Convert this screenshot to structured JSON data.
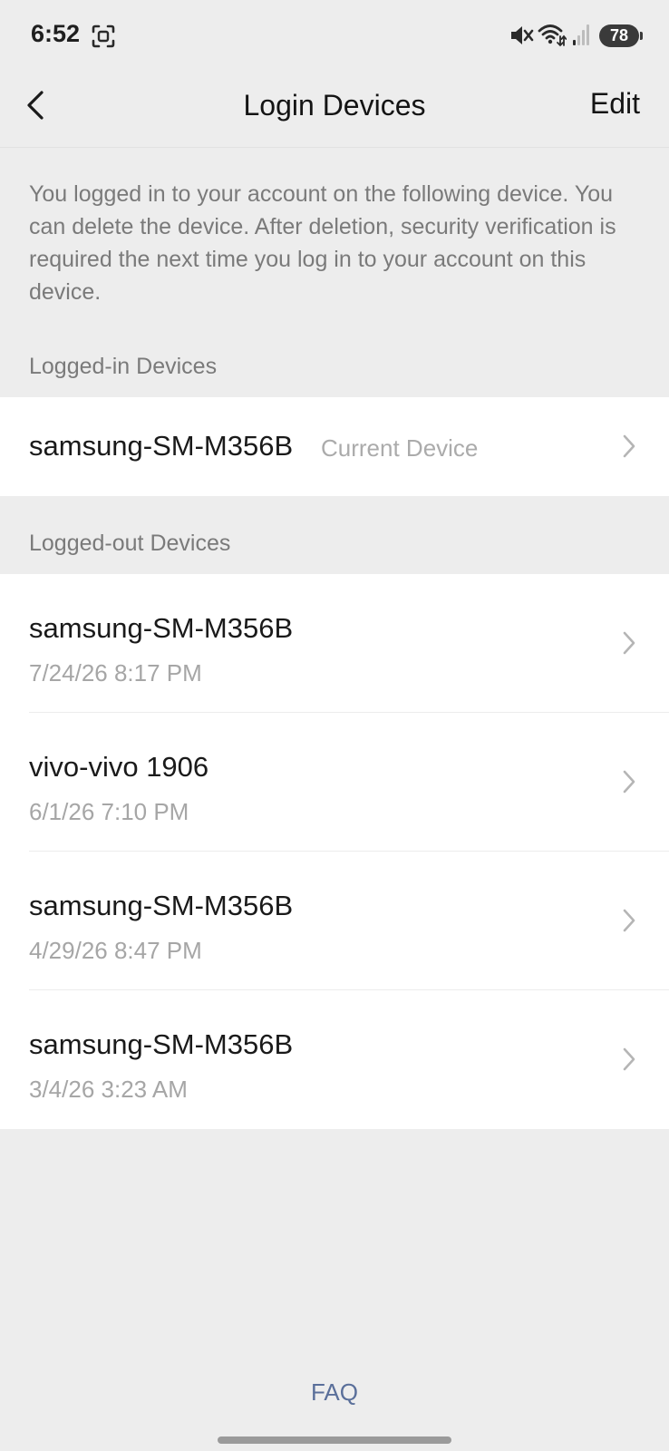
{
  "status_bar": {
    "time": "6:52",
    "battery": "78",
    "icons": [
      "screenshot-icon",
      "mute-icon",
      "wifi-icon",
      "signal-icon"
    ]
  },
  "nav": {
    "title": "Login Devices",
    "edit_label": "Edit",
    "back_icon": "chevron-left-icon"
  },
  "description": "You logged in to your account on the following device. You can delete the device. After deletion, security verification is required the next time you log in to your account on this device.",
  "logged_in": {
    "header": "Logged-in Devices",
    "devices": [
      {
        "name": "samsung-SM-M356B",
        "tag": "Current Device"
      }
    ]
  },
  "logged_out": {
    "header": "Logged-out Devices",
    "devices": [
      {
        "name": "samsung-SM-M356B",
        "date": "7/24/26 8:17 PM"
      },
      {
        "name": "vivo-vivo 1906",
        "date": "6/1/26 7:10 PM"
      },
      {
        "name": "samsung-SM-M356B",
        "date": "4/29/26 8:47 PM"
      },
      {
        "name": "samsung-SM-M356B",
        "date": "3/4/26 3:23 AM"
      }
    ]
  },
  "footer": {
    "faq_label": "FAQ"
  },
  "colors": {
    "background": "#ededed",
    "card": "#ffffff",
    "link": "#5a6f9a",
    "secondary_text": "#7a7a7a"
  }
}
